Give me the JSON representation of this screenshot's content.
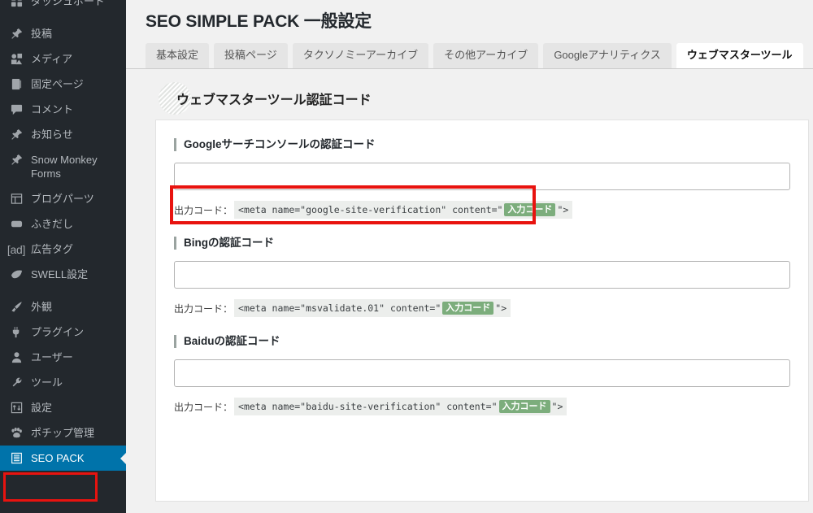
{
  "sidebar": {
    "items": [
      {
        "label": "ダッシュボード",
        "icon": "dashboard-icon",
        "clipped": true,
        "active": false
      },
      {
        "label": "投稿",
        "icon": "pin-icon",
        "active": false
      },
      {
        "label": "メディア",
        "icon": "media-icon",
        "active": false
      },
      {
        "label": "固定ページ",
        "icon": "page-icon",
        "active": false
      },
      {
        "label": "コメント",
        "icon": "comment-icon",
        "active": false
      },
      {
        "label": "お知らせ",
        "icon": "pin-icon",
        "active": false
      },
      {
        "label": "Snow Monkey Forms",
        "icon": "pin-icon",
        "active": false,
        "two_line": true
      },
      {
        "label": "ブログパーツ",
        "icon": "blocks-icon",
        "active": false
      },
      {
        "label": "ふきだし",
        "icon": "balloon-icon",
        "active": false
      },
      {
        "label": "広告タグ",
        "icon": "ad-icon",
        "active": false
      },
      {
        "label": "SWELL設定",
        "icon": "swell-icon",
        "active": false
      },
      {
        "label": "外観",
        "icon": "brush-icon",
        "active": false
      },
      {
        "label": "プラグイン",
        "icon": "plugin-icon",
        "active": false
      },
      {
        "label": "ユーザー",
        "icon": "user-icon",
        "active": false
      },
      {
        "label": "ツール",
        "icon": "wrench-icon",
        "active": false
      },
      {
        "label": "設定",
        "icon": "settings-icon",
        "active": false
      },
      {
        "label": "ポチップ管理",
        "icon": "paw-icon",
        "active": false
      },
      {
        "label": "SEO PACK",
        "icon": "list-icon",
        "active": true
      }
    ],
    "active_label": "SEO PACK",
    "active_color": "#0073aa",
    "background_color": "#23282d",
    "highlight_color": "#e8130f"
  },
  "header": {
    "title": "SEO SIMPLE PACK 一般設定"
  },
  "tabs": [
    {
      "label": "基本設定",
      "active": false
    },
    {
      "label": "投稿ページ",
      "active": false
    },
    {
      "label": "タクソノミーアーカイブ",
      "active": false
    },
    {
      "label": "その他アーカイブ",
      "active": false
    },
    {
      "label": "Googleアナリティクス",
      "active": false
    },
    {
      "label": "ウェブマスターツール",
      "active": true
    }
  ],
  "section": {
    "heading": "ウェブマスターツール認証コード"
  },
  "fields": [
    {
      "label": "Googleサーチコンソールの認証コード",
      "value": "",
      "placeholder": "",
      "hint_label": "出力コード：",
      "hint_code_before": "<meta name=\"google-site-verification\" content=\"",
      "hint_chip": "入力コード",
      "hint_code_after": "\">",
      "highlighted": true
    },
    {
      "label": "Bingの認証コード",
      "value": "",
      "placeholder": "",
      "hint_label": "出力コード：",
      "hint_code_before": "<meta name=\"msvalidate.01\" content=\"",
      "hint_chip": "入力コード",
      "hint_code_after": "\">",
      "highlighted": false
    },
    {
      "label": "Baiduの認証コード",
      "value": "",
      "placeholder": "",
      "hint_label": "出力コード：",
      "hint_code_before": "<meta name=\"baidu-site-verification\" content=\"",
      "hint_chip": "入力コード",
      "hint_code_after": "\">",
      "highlighted": false
    }
  ],
  "annotations": {
    "highlight_color": "#e8130f"
  }
}
